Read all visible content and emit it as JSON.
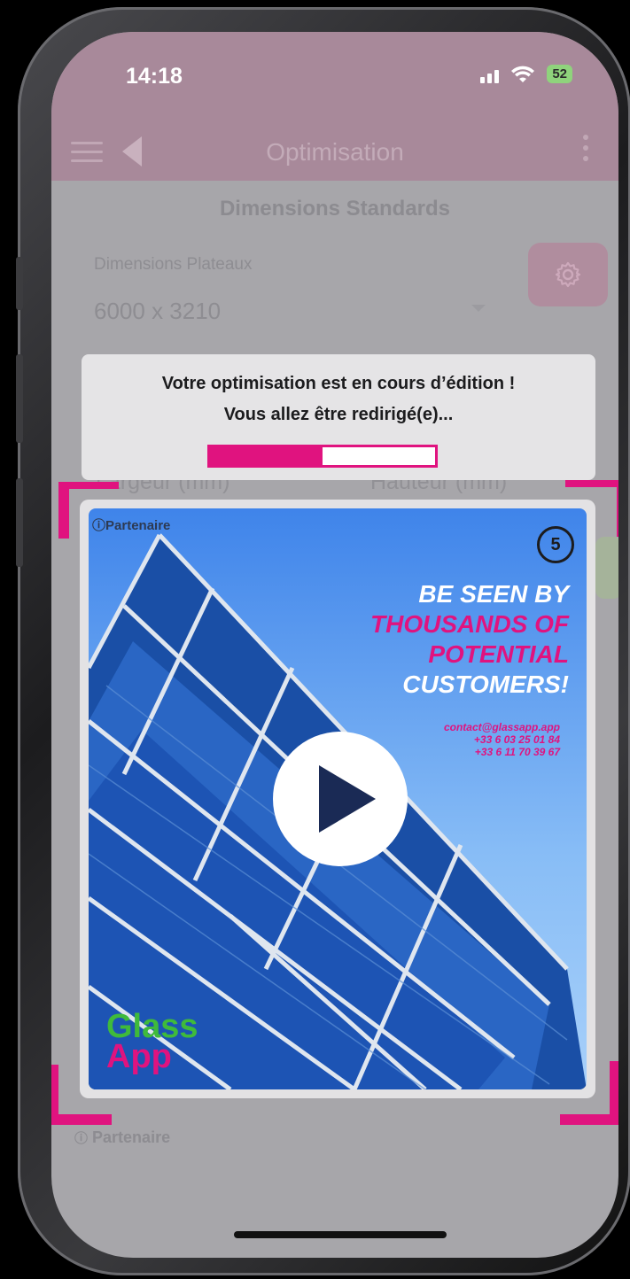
{
  "status_bar": {
    "time": "14:18",
    "battery": "52"
  },
  "app_bar": {
    "title": "Optimisation"
  },
  "content": {
    "section_title": "Dimensions Standards",
    "plateau_label": "Dimensions Plateaux",
    "plateau_value": "6000 x 3210",
    "width_label": "Largeur (mm)",
    "height_label": "Hauteur (mm)",
    "footer_partner": "Partenaire"
  },
  "toast": {
    "line1": "Votre optimisation est en cours d’édition !",
    "line2": "Vous allez être redirigé(e)...",
    "progress": 0.5
  },
  "ad": {
    "partner_label": "Partenaire",
    "countdown": "5",
    "headline": {
      "line1": "BE SEEN BY",
      "line2": "THOUSANDS OF",
      "line3": "POTENTIAL",
      "line4": "CUSTOMERS!"
    },
    "email": "contact@glassapp.app",
    "phone1": "+33 6 03 25 01 84",
    "phone2": "+33 6 11 70 39 67",
    "logo_line1": "Glass",
    "logo_line2": "App"
  },
  "colors": {
    "accent": "#e0137f",
    "logo_green": "#3fba3b",
    "app_bar": "#a8899a"
  },
  "icons": [
    "menu-icon",
    "back-icon",
    "more-icon",
    "gear-icon",
    "signal-icon",
    "wifi-icon",
    "battery-icon",
    "play-icon",
    "info-icon"
  ]
}
